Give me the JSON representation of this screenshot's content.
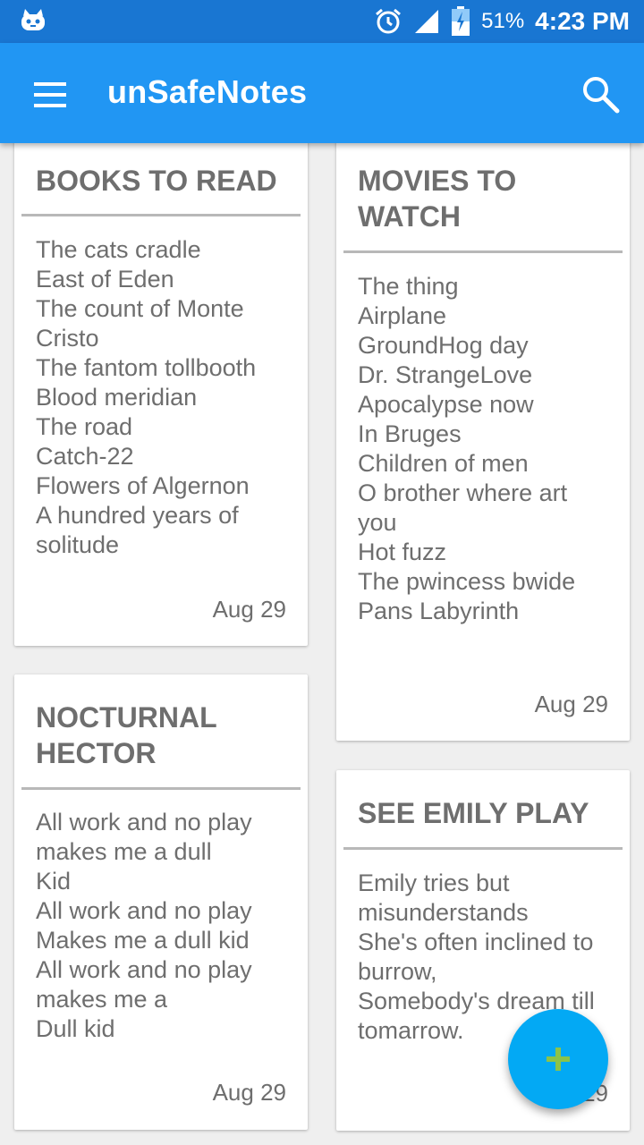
{
  "status_bar": {
    "battery_percent": "51%",
    "time": "4:23 PM",
    "icons": [
      "notification-icon",
      "alarm-icon",
      "signal-icon",
      "battery-icon"
    ]
  },
  "app_bar": {
    "title": "unSafeNotes",
    "icons": [
      "menu-icon",
      "search-icon"
    ]
  },
  "notes": [
    {
      "title": "BOOKS TO READ",
      "lines": [
        "The cats cradle",
        "East of Eden",
        "The count of Monte",
        "Cristo",
        "The fantom tollbooth",
        "Blood meridian",
        "The road",
        "Catch-22",
        "Flowers of Algernon",
        "A hundred years of",
        "solitude"
      ],
      "date": "Aug 29"
    },
    {
      "title_lines": [
        "MOVIES TO",
        "WATCH"
      ],
      "lines": [
        "The thing",
        "Airplane",
        "GroundHog day",
        "Dr. StrangeLove",
        "Apocalypse now",
        "In Bruges",
        "Children of men",
        "O brother where art",
        "you",
        "Hot fuzz",
        "The pwincess bwide",
        "Pans Labyrinth"
      ],
      "date": "Aug 29"
    },
    {
      "title_lines": [
        "NOCTURNAL",
        "HECTOR"
      ],
      "lines": [
        "All work and no play",
        "makes me a dull",
        "Kid",
        "All work and no play",
        "Makes me a dull kid",
        "All work and no play",
        "makes me a",
        "Dull kid"
      ],
      "date": "Aug 29"
    },
    {
      "title": "SEE EMILY PLAY",
      "lines": [
        "Emily tries but",
        "misunderstands",
        "She's often inclined to",
        "burrow,",
        "Somebody's dream till",
        "tomarrow."
      ],
      "date": "Aug 29"
    }
  ],
  "fab": {
    "icon": "plus-icon",
    "accent": "#8bc34a"
  },
  "colors": {
    "status_bar": "#1976d2",
    "app_bar": "#2196f3",
    "fab": "#03a9f4",
    "text": "#6e6e6e"
  }
}
